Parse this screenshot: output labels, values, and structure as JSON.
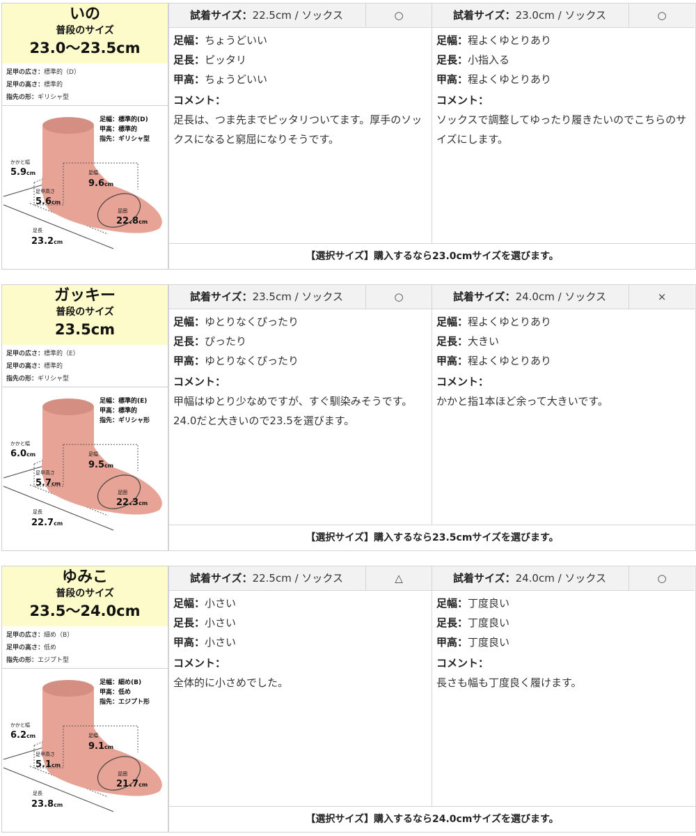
{
  "title_label": "普段のサイズ",
  "comment_label": "コメント：",
  "fields": {
    "width": "足幅：",
    "length": "足長：",
    "instep": "甲高："
  },
  "try_label": "試着サイズ：",
  "attr_labels": {
    "width": "足甲の広さ：",
    "height": "足甲の高さ：",
    "shape": "指先の形："
  },
  "diag_labels": {
    "width_l": "足幅：",
    "instep_l": "甲高：",
    "toe_l": "指先：",
    "heel": "かかと幅",
    "fw": "足幅",
    "ih": "足甲高さ",
    "girth": "足囲",
    "len": "足長"
  },
  "colors": {
    "name_bg": "#fdfbc9",
    "foot": "#e6a396",
    "header_bg": "#f2f2f2"
  },
  "people": [
    {
      "name": "いの",
      "usual_size": "23.0〜23.5cm",
      "attrs": {
        "width": "標準的（D）",
        "height": "標準的",
        "shape": "ギリシャ型"
      },
      "diagram": {
        "width": "標準的(D)",
        "instep": "標準的",
        "toe": "ギリシャ型",
        "heel_v": "5.9",
        "fw_v": "9.6",
        "ih_v": "5.6",
        "girth_v": "22.8",
        "len_v": "23.2",
        "unit": "cm"
      },
      "trials": [
        {
          "size": "22.5cm / ソックス",
          "mark": "○",
          "width": "ちょうどいい",
          "length": "ピッタリ",
          "instep": "ちょうどいい",
          "comment": "足長は、つま先までピッタリついてます。厚手のソックスになると窮屈になりそうです。"
        },
        {
          "size": "23.0cm / ソックス",
          "mark": "○",
          "width": "程よくゆとりあり",
          "length": "小指入る",
          "instep": "程よくゆとりあり",
          "comment": "ソックスで調整してゆったり履きたいのでこちらのサイズにします。"
        }
      ],
      "selection": "【選択サイズ】購入するなら23.0cmサイズを選びます。"
    },
    {
      "name": "ガッキー",
      "usual_size": "23.5cm",
      "attrs": {
        "width": "標準的（E）",
        "height": "標準的",
        "shape": "ギリシャ型"
      },
      "diagram": {
        "width": "標準的(E)",
        "instep": "標準的",
        "toe": "ギリシャ形",
        "heel_v": "6.0",
        "fw_v": "9.5",
        "ih_v": "5.7",
        "girth_v": "22.3",
        "len_v": "22.7",
        "unit": "cm"
      },
      "trials": [
        {
          "size": "23.5cm / ソックス",
          "mark": "○",
          "width": "ゆとりなくぴったり",
          "length": "ぴったり",
          "instep": "ゆとりなくぴったり",
          "comment": "甲幅はゆとり少なめですが、すぐ馴染みそうです。24.0だと大きいので23.5を選びます。"
        },
        {
          "size": "24.0cm / ソックス",
          "mark": "×",
          "width": "程よくゆとりあり",
          "length": "大きい",
          "instep": "程よくゆとりあり",
          "comment": "かかと指1本ほど余って大きいです。"
        }
      ],
      "selection": "【選択サイズ】購入するなら23.5cmサイズを選びます。"
    },
    {
      "name": "ゆみこ",
      "usual_size": "23.5〜24.0cm",
      "attrs": {
        "width": "細め（B）",
        "height": "低め",
        "shape": "エジプト型"
      },
      "diagram": {
        "width": "細め(B)",
        "instep": "低め",
        "toe": "エジプト形",
        "heel_v": "6.2",
        "fw_v": "9.1",
        "ih_v": "5.1",
        "girth_v": "21.7",
        "len_v": "23.8",
        "unit": "cm"
      },
      "trials": [
        {
          "size": "22.5cm / ソックス",
          "mark": "△",
          "width": "小さい",
          "length": "小さい",
          "instep": "小さい",
          "comment": "全体的に小さめでした。"
        },
        {
          "size": "24.0cm / ソックス",
          "mark": "○",
          "width": "丁度良い",
          "length": "丁度良い",
          "instep": "丁度良い",
          "comment": "長さも幅も丁度良く履けます。"
        }
      ],
      "selection": "【選択サイズ】購入するなら24.0cmサイズを選びます。"
    }
  ]
}
